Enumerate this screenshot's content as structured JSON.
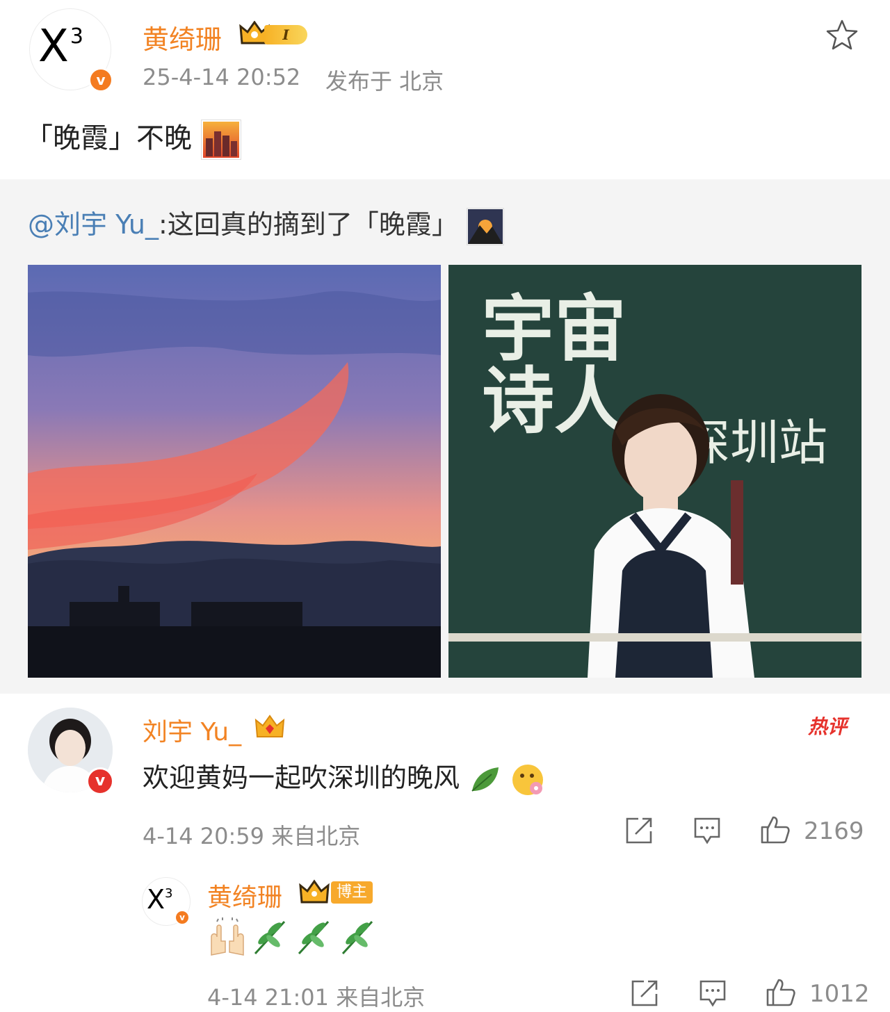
{
  "post": {
    "author": "黄绮珊",
    "level": "I",
    "date": "25-4-14 20:52",
    "location": "发布于 北京",
    "text": "「晚霞」不晚"
  },
  "repost": {
    "mention": "@刘宇 Yu_",
    "text": ":这回真的摘到了「晚霞」"
  },
  "poster": {
    "title": "宇宙诗人",
    "stop": "深圳站"
  },
  "comment": {
    "author": "刘宇 Yu_",
    "hot_label": "热评",
    "text": "欢迎黄妈一起吹深圳的晚风",
    "time": "4-14 20:59 来自北京",
    "likes": "2169"
  },
  "reply": {
    "author": "黄绮珊",
    "tag": "博主",
    "time": "4-14 21:01 来自北京",
    "likes": "1012"
  },
  "colors": {
    "username": "#f28323",
    "mention": "#4a7fb5",
    "meta": "#8c8c8c",
    "hot": "#e6322c"
  },
  "icons": [
    "star-icon",
    "share-icon",
    "comment-icon",
    "like-icon",
    "verified-icon",
    "crown-icon"
  ]
}
